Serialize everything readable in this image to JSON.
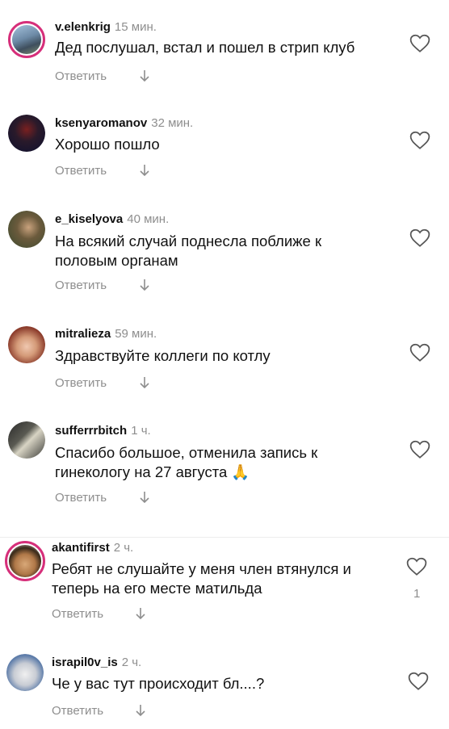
{
  "comments": [
    {
      "username": "v.elenkrig",
      "time": "15 мин.",
      "text": "Дед послушал, встал и пошел в стрип клуб",
      "reply": "Ответить",
      "avatar": "avatar-landscape-icon"
    },
    {
      "username": "ksenyaromanov",
      "time": "32 мин.",
      "text": "Хорошо пошло",
      "reply": "Ответить",
      "avatar": "avatar-dark-icon"
    },
    {
      "username": "e_kiselyova",
      "time": "40 мин.",
      "text": "На всякий случай поднесла поближе к половым органам",
      "reply": "Ответить",
      "avatar": "avatar-person-icon"
    },
    {
      "username": "mitralieza",
      "time": "59 мин.",
      "text": "Здравствуйте коллеги по котлу",
      "reply": "Ответить",
      "avatar": "avatar-girl-icon"
    },
    {
      "username": "sufferrrbitch",
      "time": "1 ч.",
      "text": "Спасибо большое, отменила запись к гинекологу на 27 августа 🙏",
      "reply": "Ответить",
      "avatar": "avatar-room-icon"
    },
    {
      "username": "akantifirst",
      "time": "2 ч.",
      "text": "Ребят не слушайте у меня член втянулся и теперь на его месте матильда",
      "reply": "Ответить",
      "likes": "1",
      "avatar": "avatar-sunglasses-icon"
    },
    {
      "username": "israpil0v_is",
      "time": "2 ч.",
      "text": "Че у вас тут происходит бл....?",
      "reply": "Ответить",
      "avatar": "avatar-car-icon"
    }
  ],
  "icons": {
    "like": "heart-outline-icon",
    "expand": "arrow-down-icon"
  }
}
